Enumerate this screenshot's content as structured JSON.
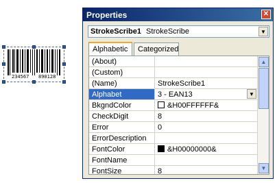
{
  "barcode": {
    "digits_left": "234567",
    "digits_right": "890128"
  },
  "properties": {
    "title": "Properties",
    "object_name": "StrokeScribe1",
    "object_type": "StrokeScribe",
    "tabs": [
      {
        "label": "Alphabetic",
        "active": true
      },
      {
        "label": "Categorized",
        "active": false
      }
    ],
    "rows": [
      {
        "name": "(About)",
        "value": ""
      },
      {
        "name": "(Custom)",
        "value": ""
      },
      {
        "name": "(Name)",
        "value": "StrokeScribe1"
      },
      {
        "name": "Alphabet",
        "value": "3 - EAN13",
        "selected": true
      },
      {
        "name": "BkgndColor",
        "value": "&H00FFFFFF&",
        "swatch": "#ffffff"
      },
      {
        "name": "CheckDigit",
        "value": "8"
      },
      {
        "name": "Error",
        "value": "0"
      },
      {
        "name": "ErrorDescription",
        "value": ""
      },
      {
        "name": "FontColor",
        "value": "&H00000000&",
        "swatch": "#000000"
      },
      {
        "name": "FontName",
        "value": ""
      },
      {
        "name": "FontSize",
        "value": "8"
      }
    ]
  },
  "icons": {
    "close": "close-icon",
    "dropdown": "chevron-down-icon",
    "scroll_up": "scroll-up-icon",
    "scroll_down": "scroll-down-icon"
  }
}
